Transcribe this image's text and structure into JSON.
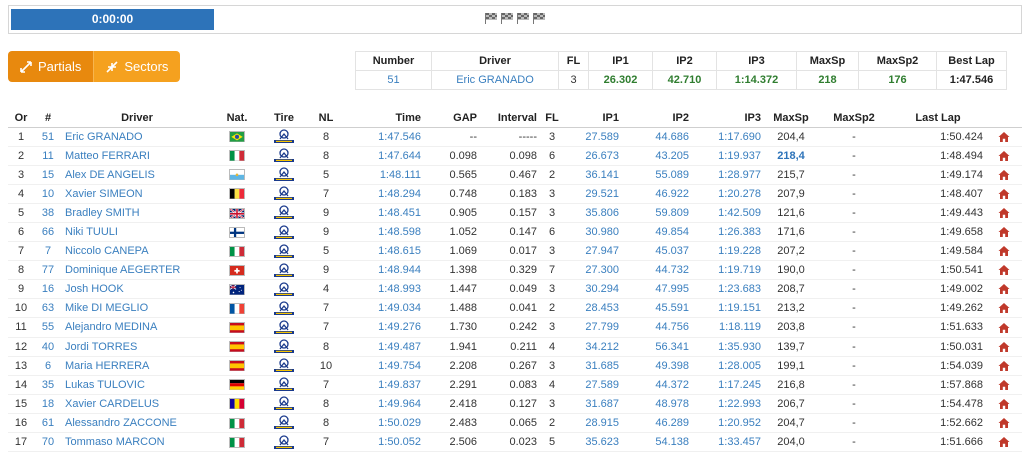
{
  "timer": "0:00:00",
  "toggles": {
    "partials": "Partials",
    "sectors": "Sectors"
  },
  "colors": {
    "accent_orange": "#f5a11f",
    "timer_blue": "#2d73b9",
    "link_blue": "#3a7fbf",
    "best_green": "#2f7d2f",
    "home_red": "#c0392b"
  },
  "best_lap": {
    "headers": [
      "Number",
      "Driver",
      "FL",
      "IP1",
      "IP2",
      "IP3",
      "MaxSp",
      "MaxSp2",
      "Best Lap"
    ],
    "row": [
      "51",
      "Eric GRANADO",
      "3",
      "26.302",
      "42.710",
      "1:14.372",
      "218",
      "176",
      "1:47.546"
    ]
  },
  "results": {
    "headers": [
      "Or",
      "#",
      "Driver",
      "Nat.",
      "Tire",
      "NL",
      "Time",
      "GAP",
      "Interval",
      "FL",
      "IP1",
      "IP2",
      "IP3",
      "MaxSp",
      "MaxSp2",
      "Last Lap",
      ""
    ],
    "rows": [
      {
        "or": "1",
        "num": "51",
        "driver": "Eric GRANADO",
        "nat": "bra",
        "nl": "8",
        "time": "1:47.546",
        "gap": "--",
        "interval": "-----",
        "fl": "3",
        "ip1": "27.589",
        "ip2": "44.686",
        "ip3": "1:17.690",
        "maxsp": "204,4",
        "maxsp2": "-",
        "last": "1:50.424"
      },
      {
        "or": "2",
        "num": "11",
        "driver": "Matteo FERRARI",
        "nat": "ita",
        "nl": "8",
        "time": "1:47.644",
        "gap": "0.098",
        "interval": "0.098",
        "fl": "6",
        "ip1": "26.673",
        "ip2": "43.205",
        "ip3": "1:19.937",
        "maxsp": "218,4",
        "maxsp2": "-",
        "last": "1:48.494",
        "maxsp_best": true
      },
      {
        "or": "3",
        "num": "15",
        "driver": "Alex DE ANGELIS",
        "nat": "smr",
        "nl": "5",
        "time": "1:48.111",
        "gap": "0.565",
        "interval": "0.467",
        "fl": "2",
        "ip1": "36.141",
        "ip2": "55.089",
        "ip3": "1:28.977",
        "maxsp": "215,7",
        "maxsp2": "-",
        "last": "1:49.174"
      },
      {
        "or": "4",
        "num": "10",
        "driver": "Xavier SIMEON",
        "nat": "bel",
        "nl": "7",
        "time": "1:48.294",
        "gap": "0.748",
        "interval": "0.183",
        "fl": "3",
        "ip1": "29.521",
        "ip2": "46.922",
        "ip3": "1:20.278",
        "maxsp": "207,9",
        "maxsp2": "-",
        "last": "1:48.407"
      },
      {
        "or": "5",
        "num": "38",
        "driver": "Bradley SMITH",
        "nat": "gbr",
        "nl": "9",
        "time": "1:48.451",
        "gap": "0.905",
        "interval": "0.157",
        "fl": "3",
        "ip1": "35.806",
        "ip2": "59.809",
        "ip3": "1:42.509",
        "maxsp": "121,6",
        "maxsp2": "-",
        "last": "1:49.443"
      },
      {
        "or": "6",
        "num": "66",
        "driver": "Niki TUULI",
        "nat": "fin",
        "nl": "9",
        "time": "1:48.598",
        "gap": "1.052",
        "interval": "0.147",
        "fl": "6",
        "ip1": "30.980",
        "ip2": "49.854",
        "ip3": "1:26.383",
        "maxsp": "171,6",
        "maxsp2": "-",
        "last": "1:49.658"
      },
      {
        "or": "7",
        "num": "7",
        "driver": "Niccolo CANEPA",
        "nat": "ita",
        "nl": "5",
        "time": "1:48.615",
        "gap": "1.069",
        "interval": "0.017",
        "fl": "3",
        "ip1": "27.947",
        "ip2": "45.037",
        "ip3": "1:19.228",
        "maxsp": "207,2",
        "maxsp2": "-",
        "last": "1:49.584"
      },
      {
        "or": "8",
        "num": "77",
        "driver": "Dominique AEGERTER",
        "nat": "sui",
        "nl": "9",
        "time": "1:48.944",
        "gap": "1.398",
        "interval": "0.329",
        "fl": "7",
        "ip1": "27.300",
        "ip2": "44.732",
        "ip3": "1:19.719",
        "maxsp": "190,0",
        "maxsp2": "-",
        "last": "1:50.541"
      },
      {
        "or": "9",
        "num": "16",
        "driver": "Josh HOOK",
        "nat": "aus",
        "nl": "4",
        "time": "1:48.993",
        "gap": "1.447",
        "interval": "0.049",
        "fl": "3",
        "ip1": "30.294",
        "ip2": "47.995",
        "ip3": "1:23.683",
        "maxsp": "208,7",
        "maxsp2": "-",
        "last": "1:49.002"
      },
      {
        "or": "10",
        "num": "63",
        "driver": "Mike DI MEGLIO",
        "nat": "fra",
        "nl": "7",
        "time": "1:49.034",
        "gap": "1.488",
        "interval": "0.041",
        "fl": "2",
        "ip1": "28.453",
        "ip2": "45.591",
        "ip3": "1:19.151",
        "maxsp": "213,2",
        "maxsp2": "-",
        "last": "1:49.262"
      },
      {
        "or": "11",
        "num": "55",
        "driver": "Alejandro MEDINA",
        "nat": "esp",
        "nl": "7",
        "time": "1:49.276",
        "gap": "1.730",
        "interval": "0.242",
        "fl": "3",
        "ip1": "27.799",
        "ip2": "44.756",
        "ip3": "1:18.119",
        "maxsp": "203,8",
        "maxsp2": "-",
        "last": "1:51.633"
      },
      {
        "or": "12",
        "num": "40",
        "driver": "Jordi TORRES",
        "nat": "esp",
        "nl": "8",
        "time": "1:49.487",
        "gap": "1.941",
        "interval": "0.211",
        "fl": "4",
        "ip1": "34.212",
        "ip2": "56.341",
        "ip3": "1:35.930",
        "maxsp": "139,7",
        "maxsp2": "-",
        "last": "1:50.031"
      },
      {
        "or": "13",
        "num": "6",
        "driver": "Maria HERRERA",
        "nat": "esp",
        "nl": "10",
        "time": "1:49.754",
        "gap": "2.208",
        "interval": "0.267",
        "fl": "3",
        "ip1": "31.685",
        "ip2": "49.398",
        "ip3": "1:28.005",
        "maxsp": "199,1",
        "maxsp2": "-",
        "last": "1:54.039"
      },
      {
        "or": "14",
        "num": "35",
        "driver": "Lukas TULOVIC",
        "nat": "ger",
        "nl": "7",
        "time": "1:49.837",
        "gap": "2.291",
        "interval": "0.083",
        "fl": "4",
        "ip1": "27.589",
        "ip2": "44.372",
        "ip3": "1:17.245",
        "maxsp": "216,8",
        "maxsp2": "-",
        "last": "1:57.868"
      },
      {
        "or": "15",
        "num": "18",
        "driver": "Xavier CARDELUS",
        "nat": "and",
        "nl": "8",
        "time": "1:49.964",
        "gap": "2.418",
        "interval": "0.127",
        "fl": "3",
        "ip1": "31.687",
        "ip2": "48.978",
        "ip3": "1:22.993",
        "maxsp": "206,7",
        "maxsp2": "-",
        "last": "1:54.478"
      },
      {
        "or": "16",
        "num": "61",
        "driver": "Alessandro ZACCONE",
        "nat": "ita",
        "nl": "8",
        "time": "1:50.029",
        "gap": "2.483",
        "interval": "0.065",
        "fl": "2",
        "ip1": "28.915",
        "ip2": "46.289",
        "ip3": "1:20.952",
        "maxsp": "204,7",
        "maxsp2": "-",
        "last": "1:52.662"
      },
      {
        "or": "17",
        "num": "70",
        "driver": "Tommaso MARCON",
        "nat": "ita",
        "nl": "7",
        "time": "1:50.052",
        "gap": "2.506",
        "interval": "0.023",
        "fl": "5",
        "ip1": "35.623",
        "ip2": "54.138",
        "ip3": "1:33.457",
        "maxsp": "204,0",
        "maxsp2": "-",
        "last": "1:51.666"
      }
    ]
  }
}
